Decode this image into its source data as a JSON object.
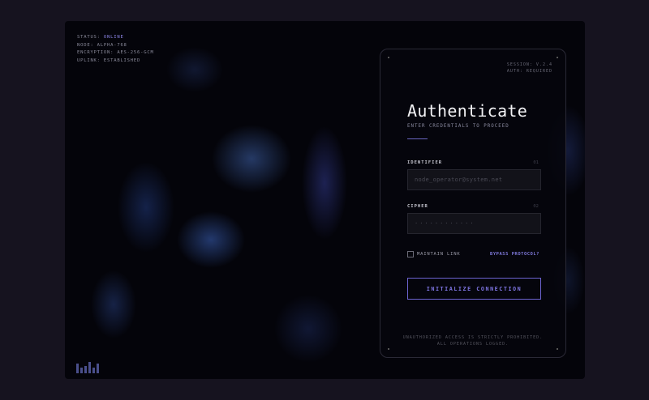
{
  "status": {
    "status_label": "STATUS: ",
    "status_value": "ONLINE",
    "node": "NODE: ALPHA-768",
    "encryption": "ENCRYPTION: AES-256-GCM",
    "uplink": "UPLINK: ESTABLISHED"
  },
  "session": {
    "version": "SESSION: V.2.4",
    "auth": "AUTH: REQUIRED"
  },
  "form": {
    "title": "Authenticate",
    "subtitle": "ENTER CREDENTIALS TO PROCEED",
    "identifier_label": "IDENTIFIER",
    "identifier_num": "01",
    "identifier_placeholder": "node_operator@system.net",
    "cipher_label": "CIPHER",
    "cipher_num": "02",
    "cipher_placeholder": "············",
    "remember_label": "MAINTAIN LINK",
    "bypass_link": "BYPASS PROTOCOL?",
    "submit": "INITIALIZE CONNECTION",
    "footer_line1": "UNAUTHORIZED ACCESS IS STRICTLY PROHIBITED.",
    "footer_line2": "ALL OPERATIONS LOGGED."
  },
  "colors": {
    "accent": "#6c63d0",
    "background": "#16131f"
  }
}
